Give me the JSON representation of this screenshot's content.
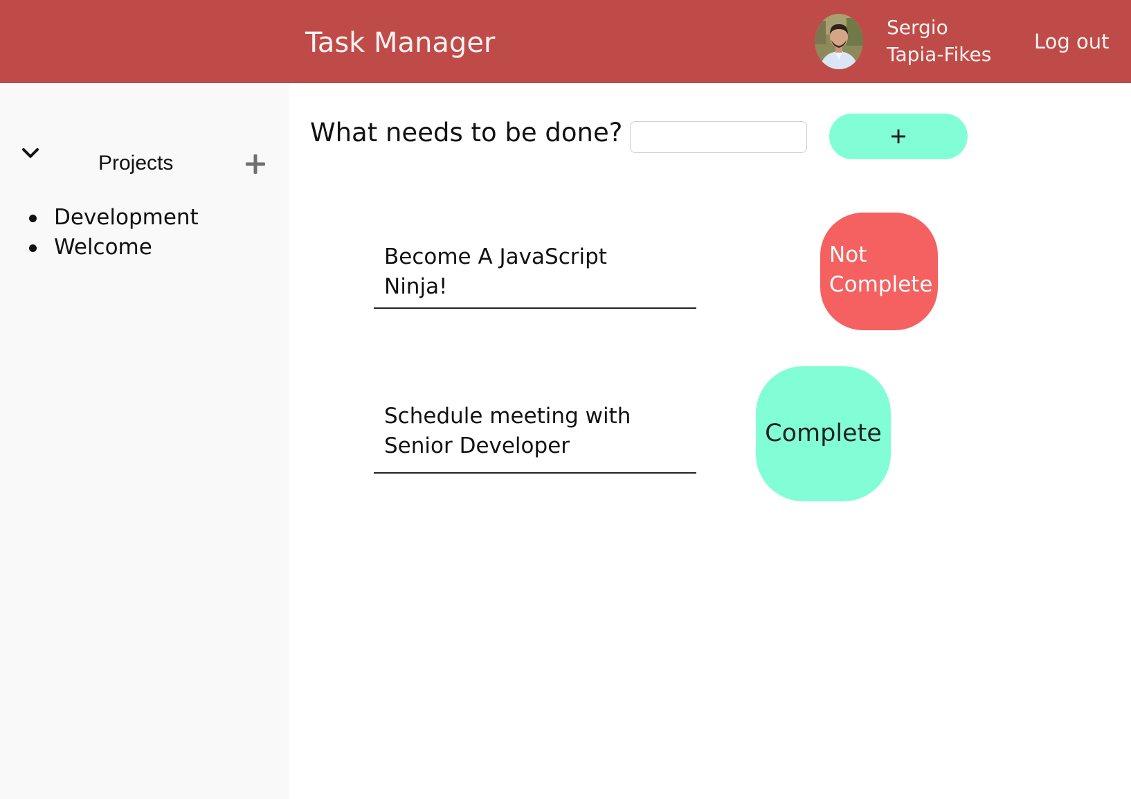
{
  "header": {
    "title": "Task Manager",
    "user_name": "Sergio Tapia-Fikes",
    "logout_label": "Log out"
  },
  "sidebar": {
    "title": "Projects",
    "projects": [
      {
        "label": "Development"
      },
      {
        "label": "Welcome"
      }
    ]
  },
  "main": {
    "prompt": "What needs to be done?",
    "new_task_input": {
      "value": "",
      "placeholder": ""
    },
    "add_button_label": "+",
    "tasks": [
      {
        "title": "Become A JavaScript Ninja!",
        "status_label": "Not Complete"
      },
      {
        "title": "Schedule meeting with Senior Developer",
        "status_label": "Complete"
      }
    ]
  },
  "icons": {
    "collapse": "chevron-down-icon",
    "add_project": "plus-icon",
    "avatar": "avatar"
  },
  "colors": {
    "header_bg": "#bf4b48",
    "header_text": "#fdf2f1",
    "sidebar_bg": "#f9f9f9",
    "accent_green": "#82fed6",
    "not_complete_red": "#f56160"
  }
}
